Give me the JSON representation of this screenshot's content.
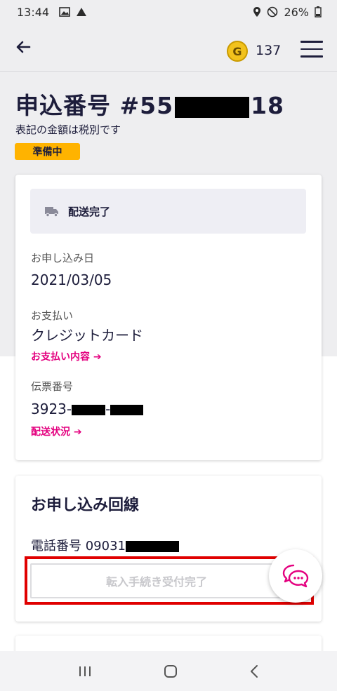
{
  "status_bar": {
    "time": "13:44",
    "battery": "26%"
  },
  "header": {
    "coin_letter": "G",
    "coin_count": "137"
  },
  "order": {
    "title_prefix": "申込番号 #55",
    "title_suffix": "18",
    "tax_note": "表記の金額は税別です",
    "status_badge": "準備中"
  },
  "details": {
    "delivery_status": "配送完了",
    "application_date_label": "お申し込み日",
    "application_date": "2021/03/05",
    "payment_label": "お支払い",
    "payment_method": "クレジットカード",
    "payment_link": "お支払い内容 ➔",
    "slip_label": "伝票番号",
    "slip_prefix": "3923-",
    "slip_dash": "-",
    "delivery_link": "配送状況 ➔"
  },
  "line": {
    "heading": "お申し込み回線",
    "phone_label": "電話番号 09031",
    "transfer_button": "転入手続き受付完了"
  },
  "colors": {
    "accent": "#e4007f",
    "badge": "#ffb300",
    "highlight": "#e00000",
    "text": "#1d1d3b"
  }
}
